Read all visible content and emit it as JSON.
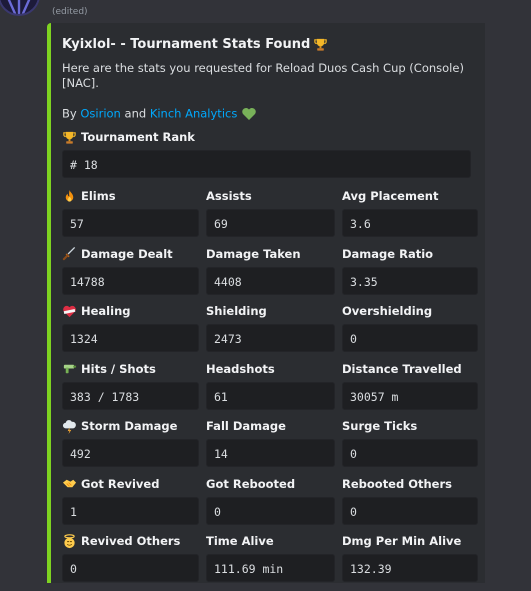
{
  "message": {
    "edited_label": "(edited)"
  },
  "embed": {
    "accent_color": "#7ed321",
    "title": "Kyixlol- - Tournament Stats Found",
    "description": "Here are the stats you requested for Reload Duos Cash Cup (Console) [NAC].",
    "byline_prefix": "By",
    "author1": "Osirion",
    "and_word": "and",
    "author2": "Kinch Analytics",
    "rank": {
      "label": "Tournament Rank",
      "value": "# 18"
    },
    "stats": [
      {
        "label": "Elims",
        "value": "57",
        "icon": "fire-icon"
      },
      {
        "label": "Assists",
        "value": "69",
        "icon": ""
      },
      {
        "label": "Avg Placement",
        "value": "3.6",
        "icon": ""
      },
      {
        "label": "Damage Dealt",
        "value": "14788",
        "icon": "dagger-icon"
      },
      {
        "label": "Damage Taken",
        "value": "4408",
        "icon": ""
      },
      {
        "label": "Damage Ratio",
        "value": "3.35",
        "icon": ""
      },
      {
        "label": "Healing",
        "value": "1324",
        "icon": "mending-heart-icon"
      },
      {
        "label": "Shielding",
        "value": "2473",
        "icon": ""
      },
      {
        "label": "Overshielding",
        "value": "0",
        "icon": ""
      },
      {
        "label": "Hits / Shots",
        "value": "383 / 1783",
        "icon": "water-pistol-icon"
      },
      {
        "label": "Headshots",
        "value": "61",
        "icon": ""
      },
      {
        "label": "Distance Travelled",
        "value": "30057 m",
        "icon": ""
      },
      {
        "label": "Storm Damage",
        "value": "492",
        "icon": "storm-cloud-icon"
      },
      {
        "label": "Fall Damage",
        "value": "14",
        "icon": ""
      },
      {
        "label": "Surge Ticks",
        "value": "0",
        "icon": ""
      },
      {
        "label": "Got Revived",
        "value": "1",
        "icon": "handshake-icon"
      },
      {
        "label": "Got Rebooted",
        "value": "0",
        "icon": ""
      },
      {
        "label": "Rebooted Others",
        "value": "0",
        "icon": ""
      },
      {
        "label": "Revived Others",
        "value": "0",
        "icon": "angel-face-icon"
      },
      {
        "label": "Time Alive",
        "value": "111.69 min",
        "icon": ""
      },
      {
        "label": "Dmg Per Min Alive",
        "value": "132.39",
        "icon": ""
      }
    ]
  }
}
